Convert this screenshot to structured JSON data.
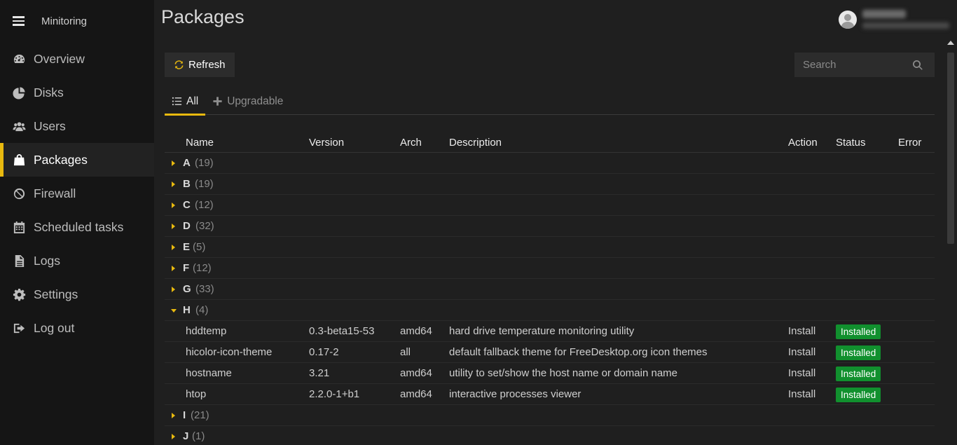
{
  "sidebar": {
    "brand": "Minitoring",
    "items": [
      {
        "label": "Overview",
        "icon": "dashboard-icon"
      },
      {
        "label": "Disks",
        "icon": "pie-chart-icon"
      },
      {
        "label": "Users",
        "icon": "users-icon"
      },
      {
        "label": "Packages",
        "icon": "shopping-bag-icon",
        "active": true
      },
      {
        "label": "Firewall",
        "icon": "ban-icon"
      },
      {
        "label": "Scheduled tasks",
        "icon": "calendar-icon"
      },
      {
        "label": "Logs",
        "icon": "document-icon"
      },
      {
        "label": "Settings",
        "icon": "gear-icon"
      },
      {
        "label": "Log out",
        "icon": "sign-out-icon"
      }
    ]
  },
  "header": {
    "title": "Packages"
  },
  "toolbar": {
    "refresh_label": "Refresh",
    "search_placeholder": "Search"
  },
  "tabs": [
    {
      "label": "All",
      "active": true
    },
    {
      "label": "Upgradable",
      "active": false
    }
  ],
  "table": {
    "columns": [
      "Name",
      "Version",
      "Arch",
      "Description",
      "Action",
      "Status",
      "Error"
    ],
    "groups": [
      {
        "letter": "A",
        "count": "(19)",
        "open": false
      },
      {
        "letter": "B",
        "count": "(19)",
        "open": false
      },
      {
        "letter": "C",
        "count": "(12)",
        "open": false
      },
      {
        "letter": "D",
        "count": "(32)",
        "open": false
      },
      {
        "letter": "E",
        "count": "(5)",
        "open": false
      },
      {
        "letter": "F",
        "count": "(12)",
        "open": false
      },
      {
        "letter": "G",
        "count": "(33)",
        "open": false
      },
      {
        "letter": "H",
        "count": "(4)",
        "open": true,
        "packages": [
          {
            "name": "hddtemp",
            "version": "0.3-beta15-53",
            "arch": "amd64",
            "description": "hard drive temperature monitoring utility",
            "action": "Install",
            "status": "Installed"
          },
          {
            "name": "hicolor-icon-theme",
            "version": "0.17-2",
            "arch": "all",
            "description": "default fallback theme for FreeDesktop.org icon themes",
            "action": "Install",
            "status": "Installed"
          },
          {
            "name": "hostname",
            "version": "3.21",
            "arch": "amd64",
            "description": "utility to set/show the host name or domain name",
            "action": "Install",
            "status": "Installed"
          },
          {
            "name": "htop",
            "version": "2.2.0-1+b1",
            "arch": "amd64",
            "description": "interactive processes viewer",
            "action": "Install",
            "status": "Installed"
          }
        ]
      },
      {
        "letter": "I",
        "count": "(21)",
        "open": false
      },
      {
        "letter": "J",
        "count": "(1)",
        "open": false
      }
    ]
  },
  "colors": {
    "accent": "#e8b90f",
    "status_installed": "#11902e",
    "sidebar_bg": "#151515",
    "main_bg": "#1f1f1f"
  }
}
